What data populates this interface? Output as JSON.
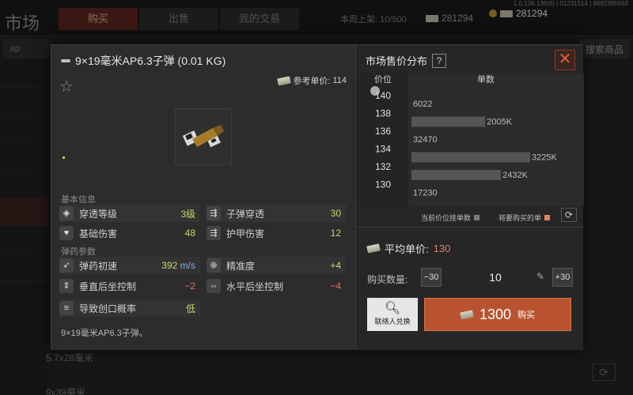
{
  "background": {
    "title": "市场",
    "tabs": [
      "购买",
      "出售",
      "我的交易"
    ],
    "active_tab": 0,
    "server_info": "1.0.136.136(6) | 01231514 | 8692395663",
    "listing_label": "本周上架: 10/500",
    "currency_1": "281294",
    "currency_2": "281294",
    "search_value": "ap",
    "search_goods_label": "搜索商品",
    "list_items": [
      "5.7x28毫米",
      "9x39毫米"
    ]
  },
  "dialog": {
    "item": {
      "name": "9×19毫米AP6.3子弹 (0.01 KG)",
      "ref_price_label": "参考单价:",
      "ref_price": "114",
      "description": "9×19毫米AP6.3子弹。"
    },
    "sections": {
      "basic": "基本信息",
      "ammo": "弹药参数"
    },
    "stats": [
      {
        "label": "穿透等级",
        "value": "3级",
        "color": "#cfd36a"
      },
      {
        "label": "子弹穿透",
        "value": "30",
        "color": "#cfd36a"
      },
      {
        "label": "基础伤害",
        "value": "48",
        "color": "#cfd36a"
      },
      {
        "label": "护甲伤害",
        "value": "12",
        "color": "#cfd36a"
      },
      {
        "label": "弹药初速",
        "value": "392",
        "unit": "m/s",
        "color": "#cfd36a"
      },
      {
        "label": "精准度",
        "value": "+4",
        "color": "#cfd36a"
      },
      {
        "label": "垂直后坐控制",
        "value": "−2",
        "color": "#e46f5a"
      },
      {
        "label": "水平后坐控制",
        "value": "−4",
        "color": "#e46f5a"
      },
      {
        "label": "导致创口概率",
        "value": "低",
        "color": "#cfd36a"
      }
    ],
    "market": {
      "title": "市场售价分布",
      "help": "?",
      "col_price": "价位",
      "col_qty": "单数",
      "legend_current": "当前价位挂单数",
      "legend_planned": "将要购买的单",
      "avg_label": "平均单价:",
      "avg_value": "130",
      "qty_label": "购买数量:",
      "minus_label": "−30",
      "plus_label": "+30",
      "qty_value": "10",
      "contact_label": "联络人兑换",
      "buy_total": "1300",
      "buy_label": "购买"
    },
    "close": "✕"
  },
  "chart_data": {
    "type": "bar",
    "orientation": "horizontal",
    "xlabel": "单数",
    "ylabel": "价位",
    "categories": [
      "140",
      "138",
      "136",
      "134",
      "132",
      "130"
    ],
    "series": [
      {
        "name": "当前价位挂单数",
        "values": [
          6022,
          2005000,
          32470,
          3225000,
          2432000,
          17230
        ]
      }
    ],
    "value_labels": [
      "6022",
      "2005K",
      "32470",
      "3225K",
      "2432K",
      "17230"
    ],
    "legend": [
      "当前价位挂单数",
      "将要购买的单"
    ],
    "legend_position": "bottom-right",
    "colors": {
      "current": "#5a5a5a",
      "planned": "#e0805e"
    }
  }
}
